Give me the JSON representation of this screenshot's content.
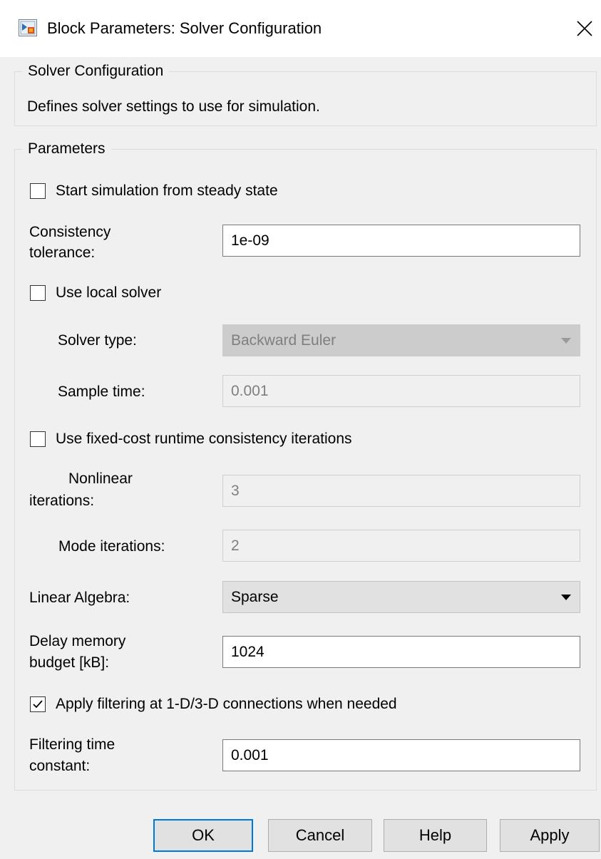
{
  "window": {
    "title": "Block Parameters: Solver Configuration",
    "app_icon": "simulink-block-icon",
    "close_icon": "close-icon"
  },
  "description_group": {
    "legend": "Solver Configuration",
    "text": "Defines solver settings to use for simulation."
  },
  "parameters_group": {
    "legend": "Parameters",
    "start_steady_state": {
      "label": "Start simulation from steady state",
      "checked": false
    },
    "consistency_tolerance": {
      "label_line1": "Consistency",
      "label_line2": "tolerance:",
      "value": "1e-09"
    },
    "use_local_solver": {
      "label": "Use local solver",
      "checked": false
    },
    "solver_type": {
      "label": "Solver type:",
      "value": "Backward Euler",
      "enabled": false
    },
    "sample_time": {
      "label": "Sample time:",
      "value": "0.001",
      "enabled": false
    },
    "fixed_cost": {
      "label": "Use fixed-cost runtime consistency iterations",
      "checked": false
    },
    "nonlinear_iterations": {
      "label_line1": "Nonlinear",
      "label_line2": "iterations:",
      "value": "3",
      "enabled": false
    },
    "mode_iterations": {
      "label": "Mode iterations:",
      "value": "2",
      "enabled": false
    },
    "linear_algebra": {
      "label": "Linear Algebra:",
      "value": "Sparse",
      "enabled": true
    },
    "delay_memory": {
      "label_line1": "Delay memory",
      "label_line2": "budget [kB]:",
      "value": "1024"
    },
    "apply_filtering": {
      "label": "Apply filtering at 1-D/3-D connections when needed",
      "checked": true
    },
    "filtering_time": {
      "label_line1": "Filtering time",
      "label_line2": "constant:",
      "value": "0.001"
    }
  },
  "buttons": {
    "ok": "OK",
    "cancel": "Cancel",
    "help": "Help",
    "apply": "Apply"
  },
  "colors": {
    "window_bg": "#f0f0f0",
    "titlebar_bg": "#ffffff",
    "default_button_border": "#0078d7",
    "disabled_text": "#7f7f7f"
  }
}
